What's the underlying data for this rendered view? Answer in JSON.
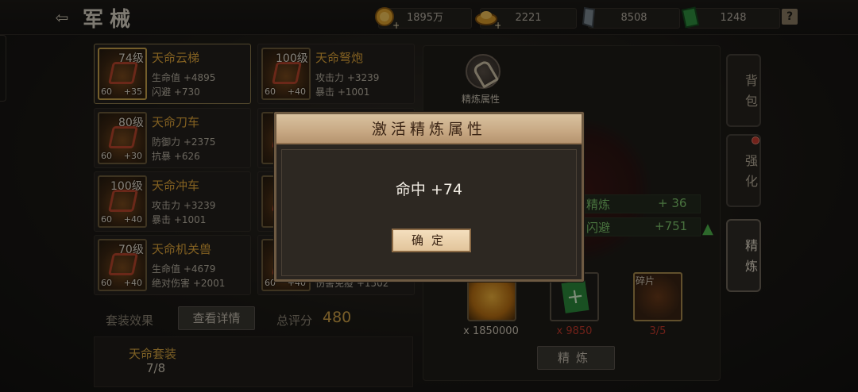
{
  "header": {
    "back_icon": "back-arrow-icon",
    "title": "军械"
  },
  "resources": [
    {
      "icon": "gold-coin-icon",
      "value": "1895万"
    },
    {
      "icon": "gold-ingot-icon",
      "value": "2221"
    },
    {
      "icon": "crystal-icon",
      "value": "8508"
    },
    {
      "icon": "green-book-icon",
      "value": "1248"
    }
  ],
  "help_label": "?",
  "equipment": [
    {
      "name": "天命云梯",
      "level": "74级",
      "left": "60",
      "right": "+35",
      "stat1": "生命值 +4895",
      "stat2": "闪避 +730",
      "selected": true
    },
    {
      "name": "天命弩炮",
      "level": "100级",
      "left": "60",
      "right": "+40",
      "stat1": "攻击力 +3239",
      "stat2": "暴击 +1001"
    },
    {
      "name": "天命刀车",
      "level": "80级",
      "left": "60",
      "right": "+30",
      "stat1": "防御力 +2375",
      "stat2": "抗暴 +626"
    },
    {
      "name": "",
      "level": "",
      "left": "",
      "right": "",
      "stat1": "",
      "stat2": ""
    },
    {
      "name": "天命冲车",
      "level": "100级",
      "left": "60",
      "right": "+40",
      "stat1": "攻击力 +3239",
      "stat2": "暴击 +1001"
    },
    {
      "name": "",
      "level": "",
      "left": "",
      "right": "",
      "stat1": "",
      "stat2": ""
    },
    {
      "name": "天命机关兽",
      "level": "70级",
      "left": "60",
      "right": "+40",
      "stat1": "生命值 +4679",
      "stat2": "绝对伤害 +2001"
    },
    {
      "name": "",
      "level": "",
      "left": "60",
      "right": "+40",
      "stat1": "",
      "stat2": "伤害免疫 +1502"
    }
  ],
  "set_effect_label": "套装效果",
  "view_details_label": "查看详情",
  "total_score_label": "总评分",
  "total_score_value": "480",
  "set_name": "天命套装",
  "set_progress": "7/8",
  "refine_panel": {
    "attr_label": "精炼属性",
    "stats": [
      {
        "name": "精炼",
        "value": "+ 36"
      },
      {
        "name": "闪避",
        "value": "+751"
      }
    ],
    "materials": [
      {
        "icon": "gold-coin-icon",
        "count": "x 1850000",
        "count_color": "#cfc6b6"
      },
      {
        "icon": "green-book-icon",
        "count": "x 9850",
        "count_color": "#c0392b"
      },
      {
        "icon": "fragment-icon",
        "count": "3/5",
        "count_color": "#c0392b",
        "tag": "碎片"
      }
    ],
    "refine_button": "精炼"
  },
  "side_tabs": [
    {
      "label": "背包",
      "active": false
    },
    {
      "label": "强化",
      "active": false,
      "badge": true
    },
    {
      "label": "精炼",
      "active": true
    }
  ],
  "dialog": {
    "title": "激活精炼属性",
    "message": "命中 +74",
    "confirm": "确定"
  }
}
